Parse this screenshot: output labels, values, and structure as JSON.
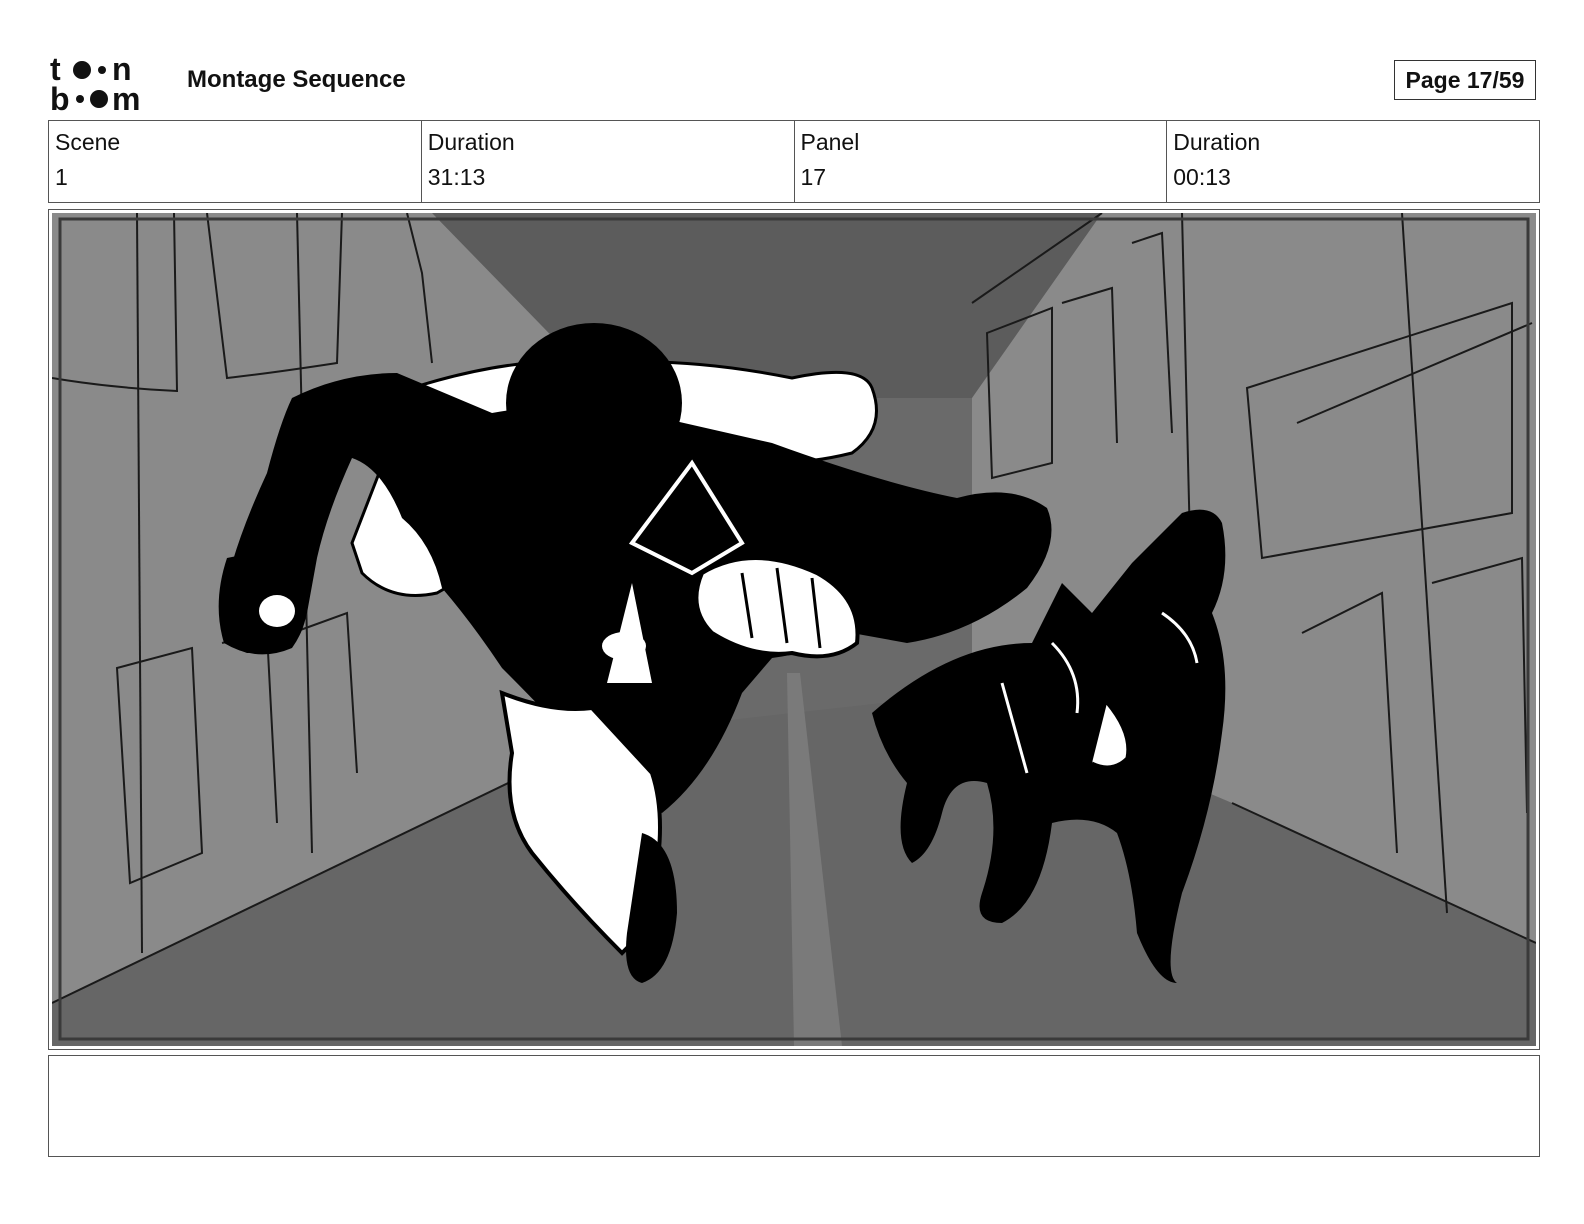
{
  "header": {
    "logo_line1": "t●●n",
    "logo_line2": "b●●m",
    "title": "Montage Sequence",
    "page_label": "Page 17/59"
  },
  "info": {
    "scene_label": "Scene",
    "scene_value": "1",
    "scene_duration_label": "Duration",
    "scene_duration_value": "31:13",
    "panel_label": "Panel",
    "panel_value": "17",
    "panel_duration_label": "Duration",
    "panel_duration_value": "00:13"
  },
  "notes": {
    "text": ""
  },
  "colors": {
    "sky": "#5e5e5e",
    "buildings": "#8a8a8a",
    "street": "#666666",
    "ink": "#000000",
    "highlight": "#ffffff"
  }
}
